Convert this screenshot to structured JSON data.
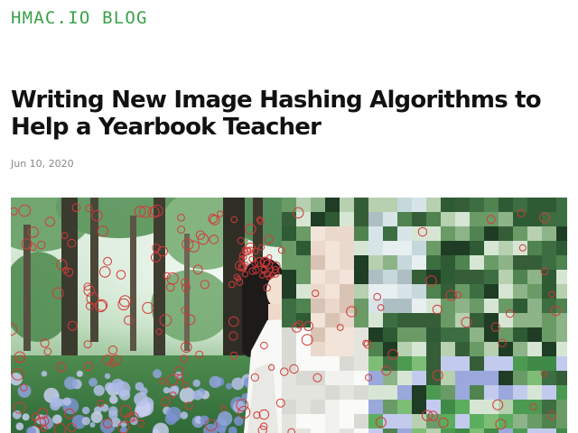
{
  "site": {
    "title": "HMAC.IO BLOG",
    "accent_color": "#3aa14a"
  },
  "post": {
    "title": "Writing New Image Hashing Algorithms to Help a Yearbook Teacher",
    "date": "Jun 10, 2020"
  },
  "hero_image": {
    "subject": "person-in-forest-photo",
    "left_half": "keypoint-circles-overlay",
    "right_half": "pixelated-mosaic",
    "marker_color": "#d23a3a"
  }
}
